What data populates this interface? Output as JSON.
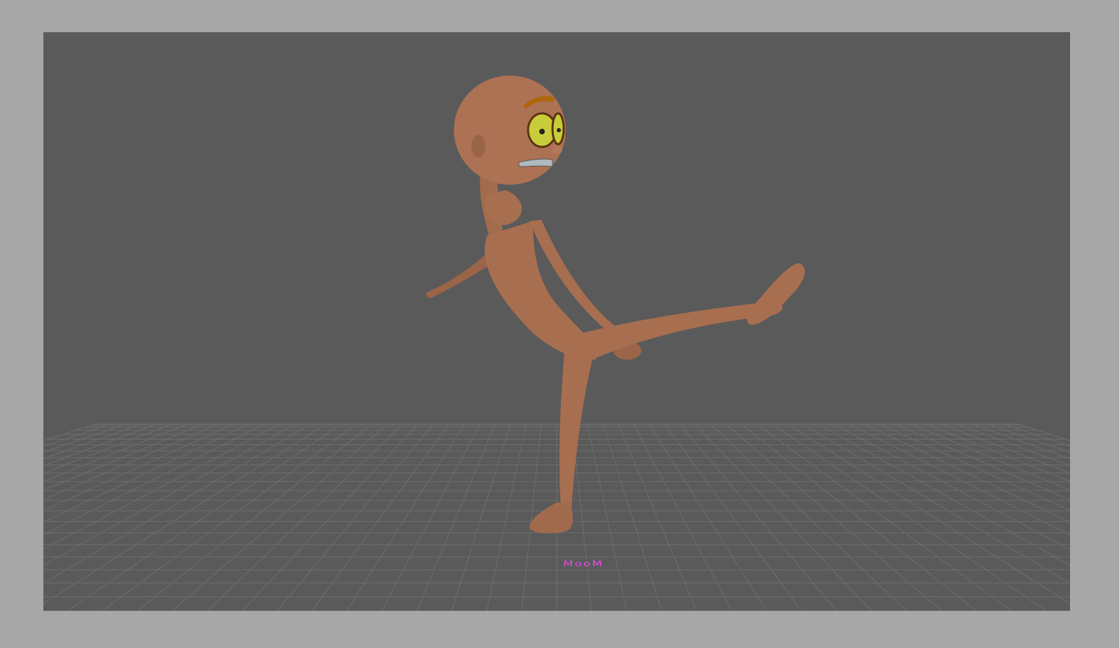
{
  "viewport": {
    "background_color": "#5a5a5a",
    "frame_color": "#a7a7a7",
    "grid_color": "#6e6e6e"
  },
  "scene": {
    "character": {
      "skin_color": "#a86e50",
      "eye_color": "#c9cc3a",
      "eyebrow_color": "#b0660a"
    },
    "ground_label": {
      "text": "MooM",
      "color": "#e64ce6"
    }
  }
}
